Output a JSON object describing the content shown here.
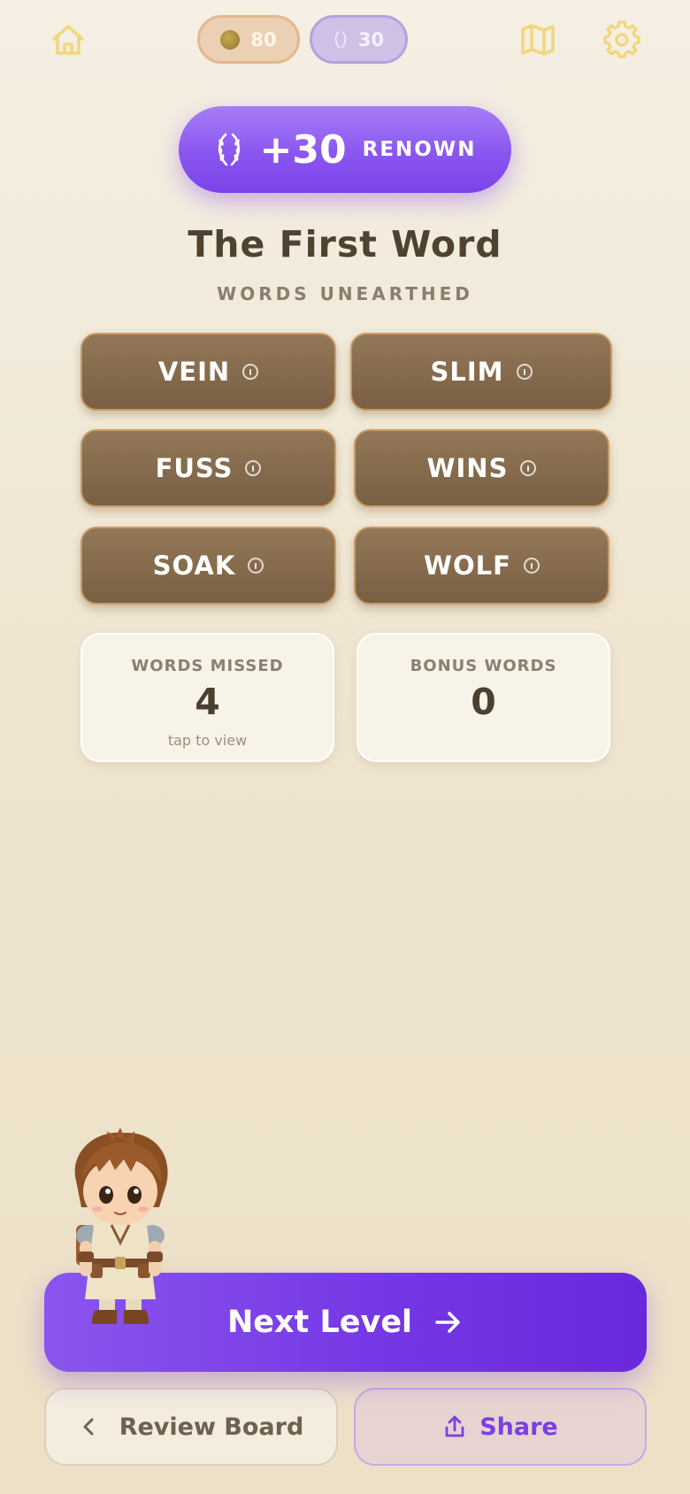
{
  "topbar": {
    "home_icon": "home-icon",
    "coins": "80",
    "coin_icon": "coin-icon",
    "renown": "30",
    "renown_icon": "laurel-icon",
    "map_icon": "map-icon",
    "settings_icon": "gear-icon"
  },
  "reward": {
    "icon": "laurel-icon",
    "amount": "+30",
    "label": "RENOWN"
  },
  "level": {
    "title": "The First Word",
    "subtitle": "WORDS UNEARTHED"
  },
  "words": [
    {
      "word": "VEIN"
    },
    {
      "word": "SLIM"
    },
    {
      "word": "FUSS"
    },
    {
      "word": "WINS"
    },
    {
      "word": "SOAK"
    },
    {
      "word": "WOLF"
    }
  ],
  "stats": {
    "missed": {
      "label": "WORDS MISSED",
      "value": "4",
      "hint": "tap to view"
    },
    "bonus": {
      "label": "BONUS WORDS",
      "value": "0"
    }
  },
  "actions": {
    "next_label": "Next Level",
    "review_label": "Review Board",
    "share_label": "Share"
  },
  "colors": {
    "accent_purple": "#7b3fe4",
    "tile_brown": "#86694b",
    "icon_gold": "#f0d77a",
    "background": "#f1e8d6"
  }
}
